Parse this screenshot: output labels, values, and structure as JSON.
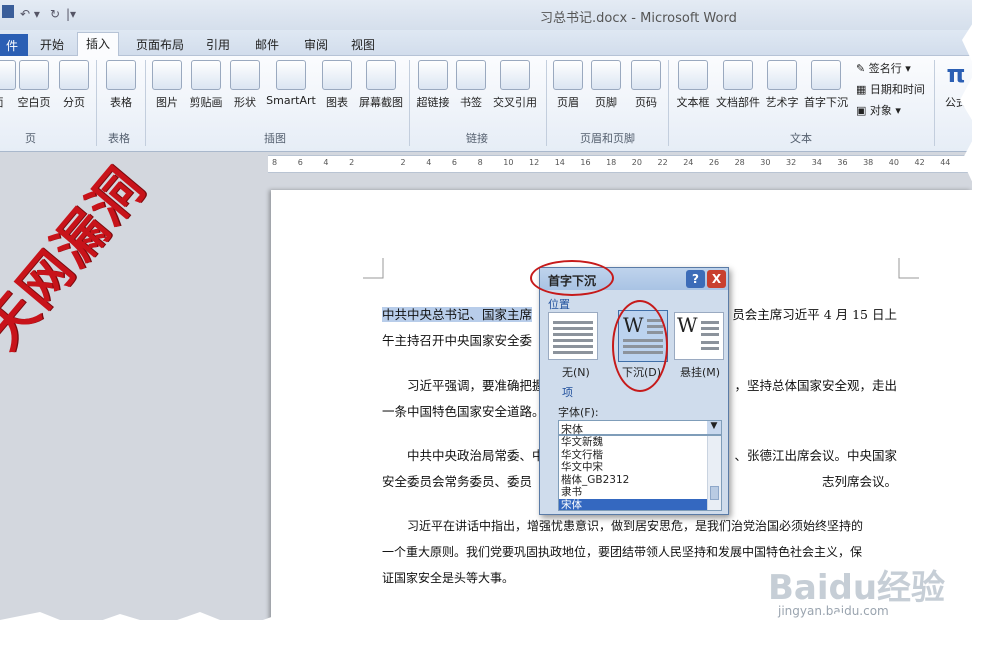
{
  "window": {
    "title": "习总书记.docx - Microsoft Word"
  },
  "tabs": [
    {
      "label": "件"
    },
    {
      "label": "开始"
    },
    {
      "label": "插入"
    },
    {
      "label": "页面布局"
    },
    {
      "label": "引用"
    },
    {
      "label": "邮件"
    },
    {
      "label": "审阅"
    },
    {
      "label": "视图"
    }
  ],
  "ribbon": {
    "buttons": [
      "面",
      "空白页",
      "分页",
      "表格",
      "图片",
      "剪贴画",
      "形状",
      "SmartArt",
      "图表",
      "屏幕截图",
      "超链接",
      "书签",
      "交叉引用",
      "页眉",
      "页脚",
      "页码",
      "文本框",
      "文档部件",
      "艺术字",
      "首字下沉",
      "公式"
    ],
    "groups": [
      "页",
      "表格",
      "插图",
      "链接",
      "页眉和页脚",
      "文本"
    ],
    "small": [
      "签名行",
      "日期和时间",
      "对象"
    ]
  },
  "ruler": [
    "8",
    "6",
    "4",
    "2",
    "",
    "2",
    "4",
    "6",
    "8",
    "10",
    "12",
    "14",
    "16",
    "18",
    "20",
    "22",
    "24",
    "26",
    "28",
    "30",
    "32",
    "34",
    "36",
    "38",
    "40",
    "42",
    "44"
  ],
  "document": {
    "paragraphs": [
      {
        "line1": "中共中央总书记、国家主席",
        "line1b": "员会主席习近平 4 月 15 日上",
        "line2": "午主持召开中央国家安全委"
      },
      {
        "line1": "习近平强调，要准确把握",
        "line1b": "，坚持总体国家安全观，走出",
        "line2": "一条中国特色国家安全道路。"
      },
      {
        "line1": "中共中央政治局常委、中",
        "line1b": "、张德江出席会议。中央国家",
        "line2": "安全委员会常务委员、委员",
        "line2b": "志列席会议。"
      },
      {
        "line1": "习近平在讲话中指出，增强忧患意识，做到居安思危，是我们治党治国必须始终坚持的",
        "line2": "一个重大原则。我们党要巩固执政地位，要团结带领人民坚持和发展中国特色社会主义，保",
        "line3": "证国家安全是头等大事。"
      }
    ],
    "stamp": "天网漏洞"
  },
  "dialog": {
    "title": "首字下沉",
    "help": "?",
    "close": "X",
    "position_label": "位置",
    "options": [
      {
        "label": "无(N)"
      },
      {
        "label": "下沉(D)"
      },
      {
        "label": "悬挂(M)"
      }
    ],
    "options_label": "项",
    "font_label": "字体(F):",
    "font_value": "宋体",
    "font_list": [
      "华文新魏",
      "华文行楷",
      "华文中宋",
      "楷体_GB2312",
      "隶书",
      "宋体"
    ]
  },
  "watermark": {
    "main": "Baidu经验",
    "sub": "jingyan.baidu.com"
  }
}
